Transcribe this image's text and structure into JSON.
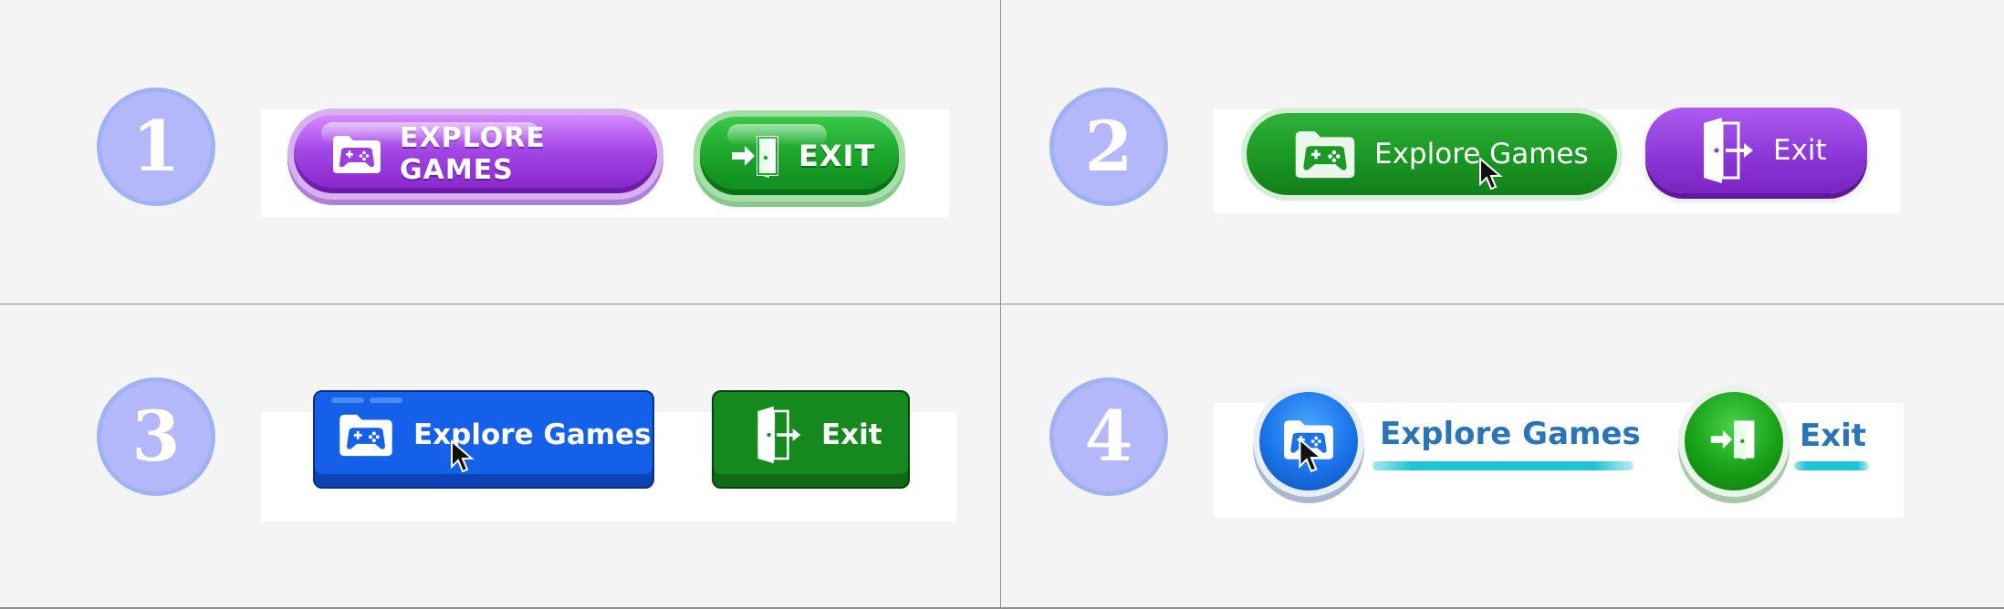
{
  "variants": [
    {
      "number": "1",
      "explore_label": "EXPLORE GAMES",
      "exit_label": "EXIT",
      "explore_color": "#a347e6",
      "exit_color": "#1aa42a"
    },
    {
      "number": "2",
      "explore_label": "Explore Games",
      "exit_label": "Exit",
      "explore_color": "#1b9a25",
      "exit_color": "#8a34d6"
    },
    {
      "number": "3",
      "explore_label": "Explore Games",
      "exit_label": "Exit",
      "explore_color": "#1560e8",
      "exit_color": "#16891e"
    },
    {
      "number": "4",
      "explore_label": "Explore Games",
      "exit_label": "Exit",
      "explore_color": "#1a73e8",
      "exit_color": "#18a018",
      "underline_color": "#20c4d6"
    }
  ],
  "icons": {
    "explore": "gamepad-folder-icon",
    "exit": "door-exit-icon",
    "cursor": "mouse-pointer-icon"
  },
  "badge_color": "#b4b8fb"
}
